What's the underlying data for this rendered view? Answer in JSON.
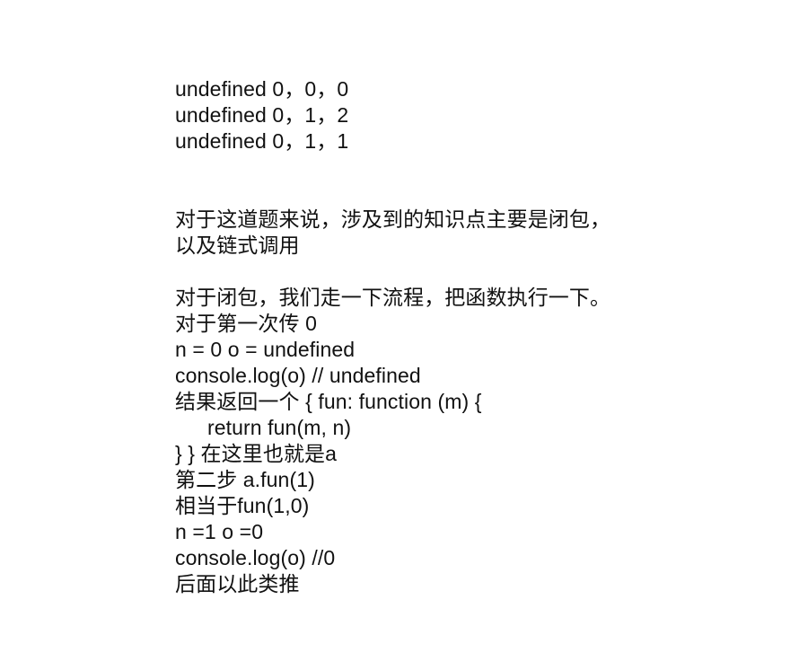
{
  "output_block": {
    "lines": [
      "undefined 0，0，0",
      "undefined 0，1，2",
      "undefined 0，1，1"
    ]
  },
  "intro_block": {
    "lines": [
      "对于这道题来说，涉及到的知识点主要是闭包，",
      "以及链式调用"
    ]
  },
  "explanation_block": {
    "lines": [
      "对于闭包，我们走一下流程，把函数执行一下。",
      "对于第一次传 0",
      "n = 0 o = undefined",
      "console.log(o) // undefined",
      "结果返回一个 { fun: function (m) {",
      "return fun(m, n)",
      "} } 在这里也就是a",
      "第二步 a.fun(1)",
      "相当于fun(1,0)",
      "n =1 o =0",
      "console.log(o) //0",
      "后面以此类推"
    ]
  }
}
